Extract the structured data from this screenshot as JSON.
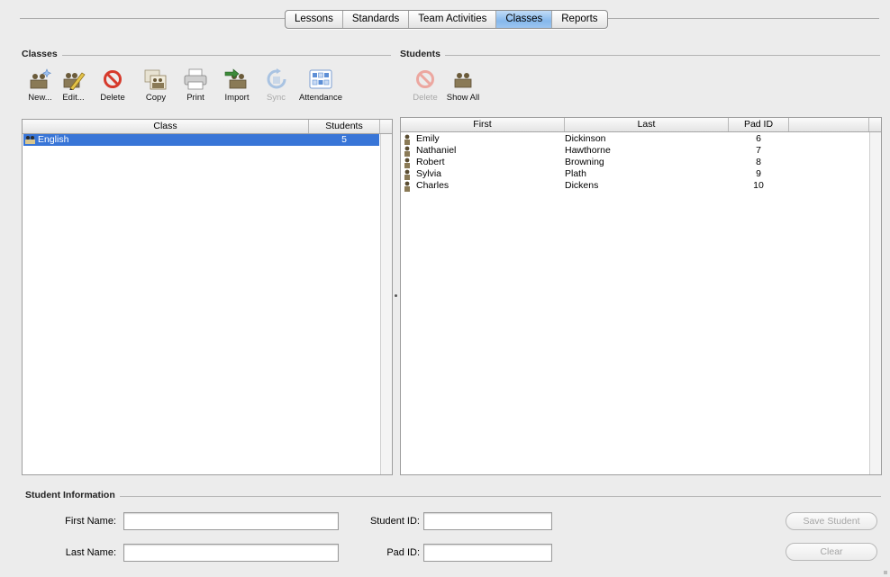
{
  "tabs": [
    {
      "label": "Lessons",
      "active": false
    },
    {
      "label": "Standards",
      "active": false
    },
    {
      "label": "Team Activities",
      "active": false
    },
    {
      "label": "Classes",
      "active": true
    },
    {
      "label": "Reports",
      "active": false
    }
  ],
  "classes_section": {
    "title": "Classes",
    "toolbar": {
      "new": "New...",
      "edit": "Edit...",
      "delete": "Delete",
      "copy": "Copy",
      "print": "Print",
      "import": "Import",
      "sync": "Sync",
      "attendance": "Attendance"
    },
    "table": {
      "headers": {
        "class": "Class",
        "students": "Students"
      },
      "rows": [
        {
          "class": "English",
          "students": "5",
          "selected": true
        }
      ]
    }
  },
  "students_section": {
    "title": "Students",
    "toolbar": {
      "delete": "Delete",
      "show_all": "Show All"
    },
    "table": {
      "headers": {
        "first": "First",
        "last": "Last",
        "pad_id": "Pad ID"
      },
      "rows": [
        {
          "first": "Emily",
          "last": "Dickinson",
          "pad_id": "6"
        },
        {
          "first": "Nathaniel",
          "last": "Hawthorne",
          "pad_id": "7"
        },
        {
          "first": "Robert",
          "last": "Browning",
          "pad_id": "8"
        },
        {
          "first": "Sylvia",
          "last": "Plath",
          "pad_id": "9"
        },
        {
          "first": "Charles",
          "last": "Dickens",
          "pad_id": "10"
        }
      ]
    }
  },
  "student_info": {
    "title": "Student Information",
    "first_name_label": "First Name:",
    "last_name_label": "Last Name:",
    "student_id_label": "Student ID:",
    "pad_id_label": "Pad ID:",
    "first_name_value": "",
    "last_name_value": "",
    "student_id_value": "",
    "pad_id_value": "",
    "save_label": "Save Student",
    "clear_label": "Clear"
  },
  "colors": {
    "selection": "#3875d7",
    "active_tab": "#86b8ec",
    "delete_red": "#d63a2c"
  }
}
